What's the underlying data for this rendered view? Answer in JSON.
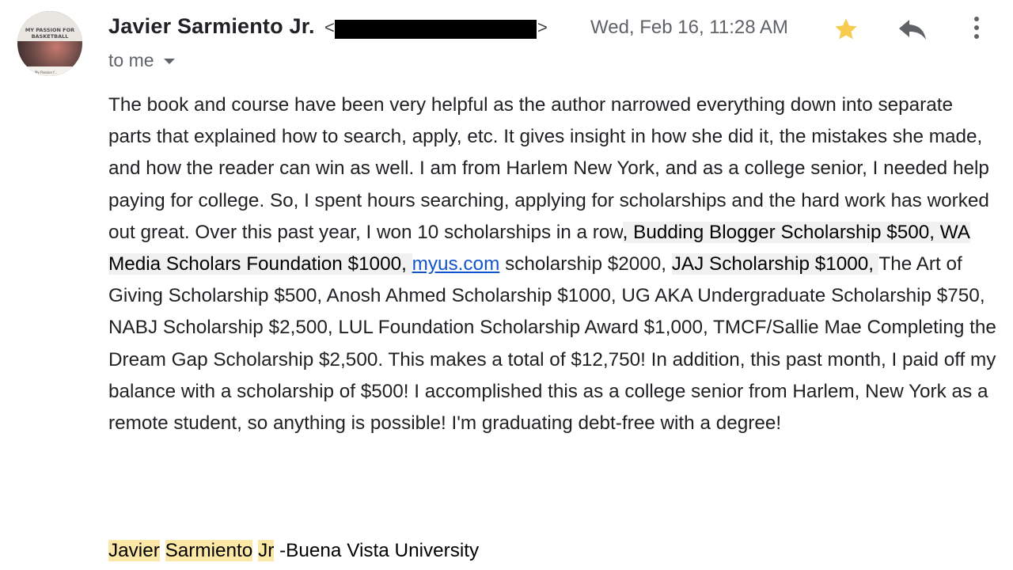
{
  "sender": {
    "name": "Javier Sarmiento Jr.",
    "email_open": "<",
    "email_close": ">",
    "avatar_text_line1": "MY PASSION FOR",
    "avatar_text_line2": "BASKETBALL",
    "avatar_caption": "My Passion f..."
  },
  "header": {
    "date": "Wed, Feb 16, 11:28 AM",
    "recipient_label": "to me",
    "star_color": "#f7cb4d"
  },
  "icons": {
    "star": "star-icon",
    "reply": "reply-icon",
    "more": "more-vert-icon",
    "chevron": "chevron-down-icon"
  },
  "body": {
    "part1": "The book and course have been very helpful as the author narrowed everything down into separate parts that explained how to search, apply, etc. It gives insight in how she did it, the mistakes she made, and how the reader can win as well. I am from Harlem New York, and as a college senior, I needed help paying for college. So, I spent hours searching, applying for scholarships and the hard work has worked out great. Over this past year, I won 10 scholarships in a row",
    "part2": ", Budding Blogger Scholarship $500, WA Media Scholars Foundation $1000,  ",
    "link": "myus.com",
    "part3": " scholarship $2000, ",
    "part4": "JAJ Scholarship  $1000, ",
    "part5": "The Art of Giving Scholarship $500, Anosh Ahmed Scholarship $1000, UG AKA Undergraduate Scholarship $750, NABJ Scholarship $2,500, LUL Foundation Scholarship Award $1,000, TMCF/Sallie Mae Completing the Dream Gap Scholarship $2,500. This makes a total of $12,750! In addition, this past month, I paid off my balance with a scholarship of $500! I accomplished this as a college senior from Harlem, New York as a remote student, so anything is possible! I'm graduating debt-free with a degree!"
  },
  "signature": {
    "first": "Javier",
    "middle": "Sarmiento",
    "last": "Jr",
    "suffix": " -Buena Vista University"
  }
}
